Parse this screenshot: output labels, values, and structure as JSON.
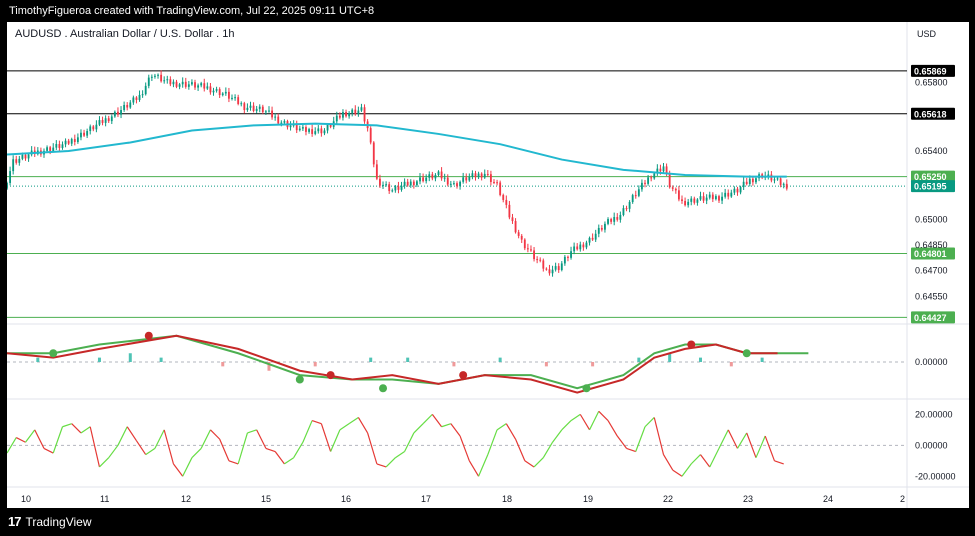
{
  "header": {
    "credit": "TimothyFigueroa created with TradingView.com, Jul 22, 2025 09:11 UTC+8"
  },
  "footer": {
    "brand": "TradingView",
    "brand_mark": "17"
  },
  "chart_data": [
    {
      "type": "candlestick",
      "title": "AUDUSD . Australian Dollar / U.S. Dollar . 1h",
      "currency": "USD",
      "ylim": [
        0.644,
        0.6595
      ],
      "y_ticks": [
        "0.65800",
        "0.65400",
        "0.65000",
        "0.64850",
        "0.64700",
        "0.64550"
      ],
      "x_ticks": [
        "10",
        "11",
        "12",
        "15",
        "16",
        "17",
        "18",
        "19",
        "22",
        "23",
        "24",
        "2"
      ],
      "horizontal_levels": [
        {
          "value": 0.65869,
          "label": "0.65869",
          "color": "#000000"
        },
        {
          "value": 0.65618,
          "label": "0.65618",
          "color": "#000000"
        },
        {
          "value": 0.6525,
          "label": "0.65250",
          "color": "#4caf50"
        },
        {
          "value": 0.65195,
          "label": "0.65195",
          "color": "#089981",
          "style": "dotted"
        },
        {
          "value": 0.64801,
          "label": "0.64801",
          "color": "#4caf50"
        },
        {
          "value": 0.64427,
          "label": "0.64427",
          "color": "#4caf50"
        }
      ],
      "close_path": [
        [
          0,
          0.6518
        ],
        [
          3,
          0.6534
        ],
        [
          10,
          0.6539
        ],
        [
          20,
          0.6544
        ],
        [
          30,
          0.6555
        ],
        [
          38,
          0.6564
        ],
        [
          44,
          0.6572
        ],
        [
          48,
          0.6585
        ],
        [
          53,
          0.658
        ],
        [
          60,
          0.6579
        ],
        [
          66,
          0.6577
        ],
        [
          72,
          0.6573
        ],
        [
          78,
          0.6566
        ],
        [
          84,
          0.6564
        ],
        [
          90,
          0.6557
        ],
        [
          97,
          0.6552
        ],
        [
          104,
          0.6552
        ],
        [
          110,
          0.6562
        ],
        [
          116,
          0.6564
        ],
        [
          118,
          0.6553
        ],
        [
          121,
          0.6523
        ],
        [
          126,
          0.6517
        ],
        [
          130,
          0.652
        ],
        [
          136,
          0.6524
        ],
        [
          141,
          0.6526
        ],
        [
          146,
          0.652
        ],
        [
          150,
          0.6524
        ],
        [
          156,
          0.6527
        ],
        [
          160,
          0.652
        ],
        [
          164,
          0.6502
        ],
        [
          168,
          0.6487
        ],
        [
          172,
          0.6478
        ],
        [
          176,
          0.647
        ],
        [
          180,
          0.6472
        ],
        [
          184,
          0.6481
        ],
        [
          190,
          0.6488
        ],
        [
          195,
          0.6497
        ],
        [
          200,
          0.6503
        ],
        [
          205,
          0.6515
        ],
        [
          210,
          0.6526
        ],
        [
          214,
          0.6531
        ],
        [
          216,
          0.652
        ],
        [
          220,
          0.651
        ],
        [
          226,
          0.6512
        ],
        [
          232,
          0.6513
        ],
        [
          238,
          0.6517
        ],
        [
          242,
          0.6523
        ],
        [
          246,
          0.6526
        ],
        [
          249,
          0.6524
        ],
        [
          253,
          0.652
        ]
      ],
      "sma_line": [
        [
          0,
          0.6538
        ],
        [
          20,
          0.654
        ],
        [
          40,
          0.6545
        ],
        [
          60,
          0.6552
        ],
        [
          80,
          0.6555
        ],
        [
          100,
          0.6556
        ],
        [
          120,
          0.6555
        ],
        [
          140,
          0.655
        ],
        [
          160,
          0.6544
        ],
        [
          180,
          0.6535
        ],
        [
          200,
          0.6529
        ],
        [
          220,
          0.6526
        ],
        [
          240,
          0.6525
        ],
        [
          253,
          0.6525
        ]
      ]
    },
    {
      "type": "line",
      "series_type": "oscillator",
      "y_ticks": [
        "0.00000"
      ],
      "ylim": [
        -0.0008,
        0.0008
      ],
      "lines": [
        {
          "color": "#4caf50",
          "points": [
            [
              0,
              0.0002
            ],
            [
              15,
              0.0002
            ],
            [
              30,
              0.0004
            ],
            [
              55,
              0.0006
            ],
            [
              75,
              0.0002
            ],
            [
              95,
              -0.0003
            ],
            [
              112,
              -0.0004
            ],
            [
              125,
              -0.0004
            ],
            [
              140,
              -0.0005
            ],
            [
              155,
              -0.0003
            ],
            [
              170,
              -0.0003
            ],
            [
              185,
              -0.0006
            ],
            [
              200,
              -0.0003
            ],
            [
              210,
              0.0002
            ],
            [
              220,
              0.0004
            ],
            [
              230,
              0.0004
            ],
            [
              240,
              0.0002
            ],
            [
              260,
              0.0002
            ]
          ]
        },
        {
          "color": "#c62828",
          "points": [
            [
              0,
              0.0002
            ],
            [
              15,
              0.0001
            ],
            [
              30,
              0.0003
            ],
            [
              55,
              0.0006
            ],
            [
              75,
              0.0003
            ],
            [
              95,
              -0.0002
            ],
            [
              112,
              -0.0004
            ],
            [
              125,
              -0.0003
            ],
            [
              140,
              -0.0005
            ],
            [
              155,
              -0.0003
            ],
            [
              170,
              -0.0004
            ],
            [
              185,
              -0.0007
            ],
            [
              200,
              -0.0004
            ],
            [
              210,
              0.0001
            ],
            [
              220,
              0.0003
            ],
            [
              230,
              0.0004
            ],
            [
              240,
              0.0002
            ],
            [
              250,
              0.0002
            ]
          ]
        }
      ],
      "histogram": [
        [
          10,
          0.0001
        ],
        [
          30,
          0.0001
        ],
        [
          40,
          0.0002
        ],
        [
          50,
          0.0001
        ],
        [
          70,
          -0.0001
        ],
        [
          85,
          -0.0002
        ],
        [
          100,
          -0.0001
        ],
        [
          118,
          0.0001
        ],
        [
          130,
          0.0001
        ],
        [
          145,
          -0.0001
        ],
        [
          160,
          0.0001
        ],
        [
          175,
          -0.0001
        ],
        [
          190,
          -0.0001
        ],
        [
          205,
          0.0001
        ],
        [
          215,
          0.0002
        ],
        [
          225,
          0.0001
        ],
        [
          235,
          -0.0001
        ],
        [
          245,
          0.0001
        ]
      ],
      "markers": [
        {
          "x": 15,
          "value": 0.0002,
          "color": "#4caf50"
        },
        {
          "x": 46,
          "value": 0.0006,
          "color": "#c62828"
        },
        {
          "x": 95,
          "value": -0.0004,
          "color": "#4caf50"
        },
        {
          "x": 105,
          "value": -0.0003,
          "color": "#c62828"
        },
        {
          "x": 122,
          "value": -0.0006,
          "color": "#4caf50"
        },
        {
          "x": 148,
          "value": -0.0003,
          "color": "#c62828"
        },
        {
          "x": 188,
          "value": -0.0006,
          "color": "#4caf50"
        },
        {
          "x": 222,
          "value": 0.0004,
          "color": "#c62828"
        },
        {
          "x": 240,
          "value": 0.0002,
          "color": "#4caf50"
        }
      ]
    },
    {
      "type": "line",
      "series_type": "oscillator",
      "y_ticks": [
        "20.00000",
        "0.00000",
        "-20.00000"
      ],
      "ylim": [
        -25,
        28
      ],
      "up_color": "#66dd44",
      "down_color": "#e53935",
      "values": [
        [
          0,
          -5
        ],
        [
          3,
          5
        ],
        [
          6,
          2
        ],
        [
          9,
          10
        ],
        [
          12,
          -2
        ],
        [
          15,
          -5
        ],
        [
          18,
          12
        ],
        [
          21,
          14
        ],
        [
          24,
          8
        ],
        [
          27,
          12
        ],
        [
          30,
          -14
        ],
        [
          33,
          -8
        ],
        [
          36,
          0
        ],
        [
          39,
          12
        ],
        [
          42,
          3
        ],
        [
          45,
          -6
        ],
        [
          48,
          -2
        ],
        [
          51,
          10
        ],
        [
          54,
          -12
        ],
        [
          57,
          -20
        ],
        [
          60,
          -8
        ],
        [
          63,
          -2
        ],
        [
          66,
          10
        ],
        [
          69,
          4
        ],
        [
          72,
          -10
        ],
        [
          75,
          -12
        ],
        [
          78,
          8
        ],
        [
          81,
          10
        ],
        [
          84,
          -2
        ],
        [
          87,
          -4
        ],
        [
          90,
          -12
        ],
        [
          93,
          -8
        ],
        [
          96,
          2
        ],
        [
          99,
          16
        ],
        [
          102,
          14
        ],
        [
          105,
          -4
        ],
        [
          108,
          10
        ],
        [
          111,
          14
        ],
        [
          114,
          18
        ],
        [
          117,
          8
        ],
        [
          120,
          -12
        ],
        [
          123,
          -14
        ],
        [
          126,
          -8
        ],
        [
          129,
          -4
        ],
        [
          132,
          8
        ],
        [
          135,
          14
        ],
        [
          138,
          20
        ],
        [
          141,
          12
        ],
        [
          144,
          14
        ],
        [
          147,
          6
        ],
        [
          150,
          -10
        ],
        [
          153,
          -20
        ],
        [
          156,
          -6
        ],
        [
          159,
          10
        ],
        [
          162,
          14
        ],
        [
          165,
          4
        ],
        [
          168,
          -10
        ],
        [
          171,
          -14
        ],
        [
          174,
          -8
        ],
        [
          177,
          2
        ],
        [
          180,
          10
        ],
        [
          183,
          16
        ],
        [
          186,
          20
        ],
        [
          189,
          10
        ],
        [
          192,
          22
        ],
        [
          195,
          16
        ],
        [
          198,
          6
        ],
        [
          201,
          -2
        ],
        [
          204,
          -4
        ],
        [
          207,
          12
        ],
        [
          210,
          18
        ],
        [
          213,
          -6
        ],
        [
          216,
          -16
        ],
        [
          219,
          -20
        ],
        [
          222,
          -12
        ],
        [
          225,
          -6
        ],
        [
          228,
          -14
        ],
        [
          231,
          -2
        ],
        [
          234,
          10
        ],
        [
          237,
          -2
        ],
        [
          240,
          8
        ],
        [
          243,
          -8
        ],
        [
          246,
          6
        ],
        [
          249,
          -10
        ],
        [
          252,
          -12
        ]
      ]
    }
  ]
}
